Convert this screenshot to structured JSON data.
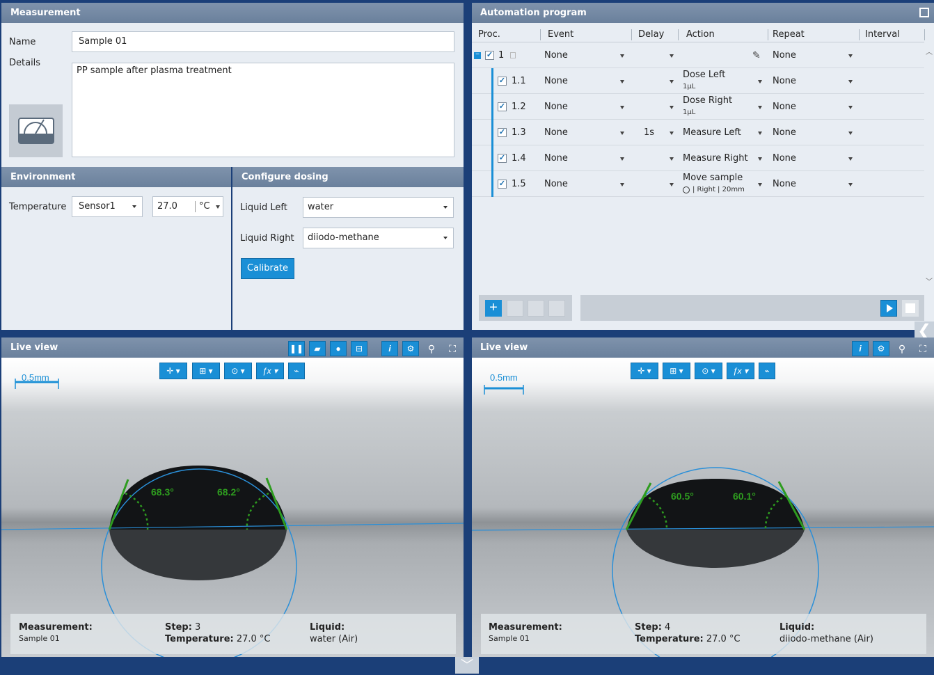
{
  "measurement": {
    "title": "Measurement",
    "name_label": "Name",
    "name_value": "Sample 01",
    "details_label": "Details",
    "details_value": "PP sample after plasma treatment"
  },
  "environment": {
    "title": "Environment",
    "temperature_label": "Temperature",
    "sensor": "Sensor1",
    "temp_value": "27.0",
    "temp_unit": "°C"
  },
  "dosing": {
    "title": "Configure dosing",
    "liquid_left_label": "Liquid Left",
    "liquid_left": "water",
    "liquid_right_label": "Liquid Right",
    "liquid_right": "diiodo-methane",
    "calibrate": "Calibrate"
  },
  "automation": {
    "title": "Automation program",
    "columns": [
      "Proc.",
      "Event",
      "Delay",
      "Action",
      "Repeat",
      "Interval"
    ],
    "rows": [
      {
        "proc": "1",
        "event": "None",
        "delay": "",
        "action": "",
        "action_sub": "",
        "repeat": "None"
      },
      {
        "proc": "1.1",
        "event": "None",
        "delay": "",
        "action": "Dose Left",
        "action_sub": "1μL",
        "repeat": "None"
      },
      {
        "proc": "1.2",
        "event": "None",
        "delay": "",
        "action": "Dose Right",
        "action_sub": "1μL",
        "repeat": "None"
      },
      {
        "proc": "1.3",
        "event": "None",
        "delay": "1s",
        "action": "Measure Left",
        "action_sub": "",
        "repeat": "None"
      },
      {
        "proc": "1.4",
        "event": "None",
        "delay": "",
        "action": "Measure Right",
        "action_sub": "",
        "repeat": "None"
      },
      {
        "proc": "1.5",
        "event": "None",
        "delay": "",
        "action": "Move sample",
        "action_sub": "| Right | 20mm",
        "repeat": "None"
      }
    ]
  },
  "live_left": {
    "title": "Live view",
    "scale": "0.5mm",
    "angle_left": "68.3°",
    "angle_right": "68.2°",
    "measurement_label": "Measurement:",
    "measurement_value": "Sample 01",
    "step_label": "Step:",
    "step_value": "3",
    "temperature_label": "Temperature:",
    "temperature_value": "27.0 °C",
    "liquid_label": "Liquid:",
    "liquid_value": "water (Air)"
  },
  "live_right": {
    "title": "Live view",
    "scale": "0.5mm",
    "angle_left": "60.5°",
    "angle_right": "60.1°",
    "measurement_label": "Measurement:",
    "measurement_value": "Sample 01",
    "step_label": "Step:",
    "step_value": "4",
    "temperature_label": "Temperature:",
    "temperature_value": "27.0 °C",
    "liquid_label": "Liquid:",
    "liquid_value": "diiodo-methane (Air)"
  },
  "colors": {
    "accent": "#1a8fd6",
    "header": "#7388a3",
    "angle_green": "#2e9c1f",
    "fit_blue": "#2a8fd8"
  }
}
